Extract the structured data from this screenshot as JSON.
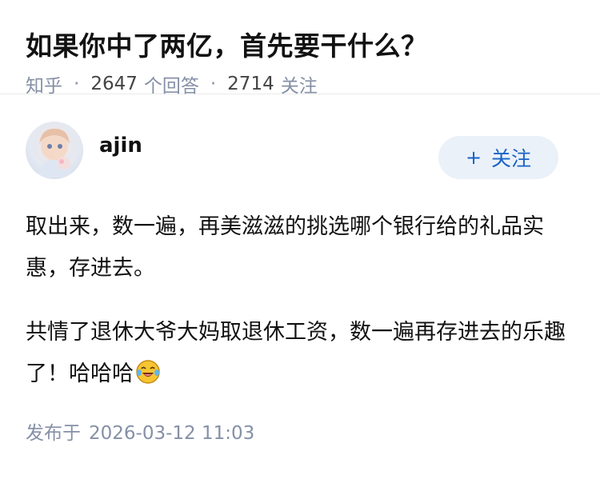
{
  "question": {
    "title": "如果你中了两亿，首先要干什么？",
    "source": "知乎",
    "answer_count": "2647",
    "answer_label": "个回答",
    "follower_count": "2714",
    "follower_label": "关注"
  },
  "answer": {
    "author": "ajin",
    "follow_button": "关注",
    "paragraphs": [
      "取出来，数一遍，再美滋滋的挑选哪个银行给的礼品实惠，存进去。",
      "共情了退休大爷大妈取退休工资，数一遍再存进去的乐趣了！哈哈哈"
    ],
    "emoji": "laughing-tears-emoji",
    "published_label": "发布于",
    "published_time": "2026-03-12 11:03"
  },
  "colors": {
    "meta_gray": "#8590a6",
    "follow_bg": "#ebf1f9",
    "follow_text": "#1763c6"
  }
}
